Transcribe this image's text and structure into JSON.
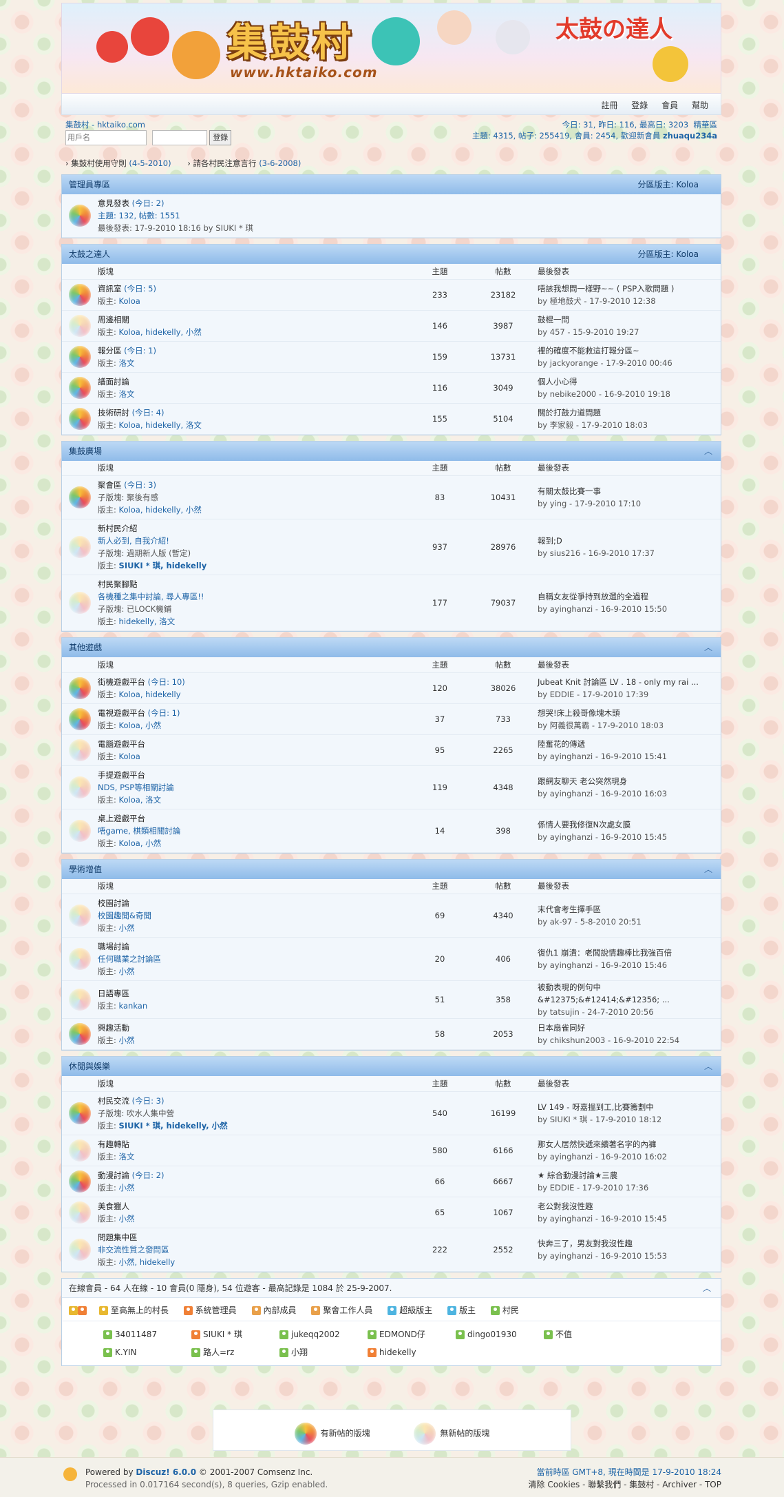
{
  "banner": {
    "title": "集鼓村",
    "url": "www.hktaiko.com",
    "logo2": "太鼓の達人"
  },
  "nav": [
    "註冊",
    "登錄",
    "會員",
    "幫助"
  ],
  "userbar": {
    "site": "集鼓村 - hktaiko.com",
    "user_placeholder": "用戶名",
    "login": "登錄",
    "stats1": "今日: 31, 昨日: 116, 最高日: 3203",
    "digest": "精華區",
    "stats2": "主題: 4315, 帖子: 255419, 會員: 2454, 歡迎新會員 ",
    "newmember": "zhuaqu234a",
    "notices": [
      {
        "title": "集鼓村使用守則",
        "date": "(4-5-2010)"
      },
      {
        "title": "請各村民注意言行",
        "date": "(3-6-2008)"
      }
    ]
  },
  "headers": {
    "forum": "版塊",
    "threads": "主題",
    "posts": "帖數",
    "last": "最後發表"
  },
  "cat_admin": {
    "name": "管理員專區",
    "mod": "分區版主: Koloa",
    "forum": {
      "name": "意見發表",
      "today": "(今日: 2)",
      "stats": "主題: 132, 帖數: 1551",
      "last": "最後發表: 17-9-2010 18:16 by ",
      "last_by": "SIUKI * 琪"
    }
  },
  "categories": [
    {
      "name": "太鼓之達人",
      "mod": "分區版主: Koloa",
      "forums": [
        {
          "name": "資訊室",
          "today": "(今日: 5)",
          "mods": "Koloa",
          "t": "233",
          "p": "23182",
          "lt": "唔該我想問一樣野~~ ( PSP入歌問題 )",
          "lb": "by 極地鼓犬 - 17-9-2010 12:38",
          "new": true
        },
        {
          "name": "周邊相關",
          "mods": "Koloa, hidekelly, 小然",
          "t": "146",
          "p": "3987",
          "lt": "鼓棍一問",
          "lb": "by 457 - 15-9-2010 19:27",
          "new": false
        },
        {
          "name": "報分區",
          "today": "(今日: 1)",
          "mods": "洛文",
          "t": "159",
          "p": "13731",
          "lt": "裡的確度不能救這打報分區~",
          "lb": "by jackyorange - 17-9-2010 00:46",
          "new": true
        },
        {
          "name": "譜面討論",
          "mods": "洛文",
          "t": "116",
          "p": "3049",
          "lt": "個人小心得",
          "lb": "by nebike2000 - 16-9-2010 19:18",
          "new": true
        },
        {
          "name": "技術研討",
          "today": "(今日: 4)",
          "mods": "Koloa, hidekelly, 洛文",
          "t": "155",
          "p": "5104",
          "lt": "關於打鼓力道問題",
          "lb": "by 李家毅 - 17-9-2010 18:03",
          "new": true
        }
      ]
    },
    {
      "name": "集鼓廣場",
      "mod": "",
      "forums": [
        {
          "name": "聚會區",
          "today": "(今日: 3)",
          "sub": "子版塊: 聚後有感",
          "mods": "Koloa, hidekelly, 小然",
          "t": "83",
          "p": "10431",
          "lt": "有關太鼓比賽一事",
          "lb": "by ying - 17-9-2010 17:10",
          "new": true
        },
        {
          "name": "新村民介紹",
          "desc": "新人必到, 自我介紹!",
          "sub": "子版塊: 過期新人版 (暫定)",
          "mods": "SIUKI * 琪, hidekelly",
          "t": "937",
          "p": "28976",
          "lt": "報到;D",
          "lb": "by sius216 - 16-9-2010 17:37",
          "new": false,
          "boldmods": true
        },
        {
          "name": "村民聚腳點",
          "desc": "各機種之集中討論, 尋人專區!!",
          "sub": "子版塊: 已LOCK機鋪",
          "mods": "hidekelly, 洛文",
          "t": "177",
          "p": "79037",
          "lt": "自稱女友從爭持到放還的全過程",
          "lb": "by ayinghanzi - 16-9-2010 15:50",
          "new": false
        }
      ]
    },
    {
      "name": "其他遊戲",
      "mod": "",
      "forums": [
        {
          "name": "街機遊戲平台",
          "today": "(今日: 10)",
          "mods": "Koloa, hidekelly",
          "t": "120",
          "p": "38026",
          "lt": "Jubeat Knit 討論區 LV . 18 - only my rai ...",
          "lb": "by EDDIE - 17-9-2010 17:39",
          "new": true
        },
        {
          "name": "電視遊戲平台",
          "today": "(今日: 1)",
          "mods": "Koloa, 小然",
          "t": "37",
          "p": "733",
          "lt": "想哭!床上殺哥像塊木頭",
          "lb": "by 阿義很萬霸 - 17-9-2010 18:03",
          "new": true
        },
        {
          "name": "電腦遊戲平台",
          "mods": "Koloa",
          "t": "95",
          "p": "2265",
          "lt": "陸奮花的傳遞",
          "lb": "by ayinghanzi - 16-9-2010 15:41",
          "new": false
        },
        {
          "name": "手提遊戲平台",
          "desc": "NDS, PSP等相關討論",
          "mods": "Koloa, 洛文",
          "t": "119",
          "p": "4348",
          "lt": "跟網友聊天 老公突然現身",
          "lb": "by ayinghanzi - 16-9-2010 16:03",
          "new": false
        },
        {
          "name": "桌上遊戲平台",
          "desc": "唔game, 棋類相關討論",
          "mods": "Koloa, 小然",
          "t": "14",
          "p": "398",
          "lt": "係情人要我修復N次處女膜",
          "lb": "by ayinghanzi - 16-9-2010 15:45",
          "new": false
        }
      ]
    },
    {
      "name": "學術增值",
      "mod": "",
      "forums": [
        {
          "name": "校園討論",
          "desc": "校園趣聞&奇聞",
          "mods": "小然",
          "t": "69",
          "p": "4340",
          "lt": "末代會考生擇手區",
          "lb": "by ak-97 - 5-8-2010 20:51",
          "new": false
        },
        {
          "name": "職場討論",
          "desc": "任何職業之討論區",
          "mods": "小然",
          "t": "20",
          "p": "406",
          "lt": "復仇1 崩潰：老闆說情趣棒比我強百倍",
          "lb": "by ayinghanzi - 16-9-2010 15:46",
          "new": false
        },
        {
          "name": "日語專區",
          "mods": "kankan",
          "t": "51",
          "p": "358",
          "lt": "被動表現的例句中&#12375;&#12414;&#12356; ...",
          "lb": "by tatsujin - 24-7-2010 20:56",
          "new": false
        },
        {
          "name": "興趣活動",
          "mods": "小然",
          "t": "58",
          "p": "2053",
          "lt": "日本扇雀同好",
          "lb": "by chikshun2003 - 16-9-2010 22:54",
          "new": true
        }
      ]
    },
    {
      "name": "休閒與娛樂",
      "mod": "",
      "forums": [
        {
          "name": "村民交流",
          "today": "(今日: 3)",
          "sub": "子版塊: 吹水人集中營",
          "mods": "SIUKI * 琪, hidekelly, 小然",
          "t": "540",
          "p": "16199",
          "lt": "LV 149 - 呀嘉搵到工,比賽籌劃中",
          "lb": "by SIUKI * 琪 - 17-9-2010 18:12",
          "new": true,
          "boldmods": true
        },
        {
          "name": "有趣轉貼",
          "mods": "洛文",
          "t": "580",
          "p": "6166",
          "lt": "那女人居然快遞來續著名字的內褲",
          "lb": "by ayinghanzi - 16-9-2010 16:02",
          "new": false
        },
        {
          "name": "動漫討論",
          "today": "(今日: 2)",
          "mods": "小然",
          "t": "66",
          "p": "6667",
          "lt": "★ 綜合動漫討論★三農",
          "lb": "by EDDIE - 17-9-2010 17:36",
          "new": true
        },
        {
          "name": "美食獵人",
          "mods": "小然",
          "t": "65",
          "p": "1067",
          "lt": "老公對我沒性趣",
          "lb": "by ayinghanzi - 16-9-2010 15:45",
          "new": false
        },
        {
          "name": "問題集中區",
          "desc": "非交流性質之發問區",
          "mods": "小然, hidekelly",
          "t": "222",
          "p": "2552",
          "lt": "快奔三了，男友對我沒性趣",
          "lb": "by ayinghanzi - 16-9-2010 15:53",
          "new": false
        }
      ]
    }
  ],
  "online": {
    "head": "在線會員 - 64 人在線 - 10 會員(0 隱身), 54 位遊客 - 最高記錄是 1084 於 25-9-2007.",
    "legend": [
      "至高無上的村長",
      "系統管理員",
      "內部成員",
      "聚會工作人員",
      "超級版主",
      "版主",
      "村民"
    ],
    "users": [
      [
        "34011487",
        "SIUKI * 琪",
        "jukeqq2002",
        "EDMOND仔",
        "dingo01930",
        "不值"
      ],
      [
        "K.YIN",
        "路人=rz",
        "小翔",
        "hidekelly"
      ]
    ]
  },
  "legendbox": {
    "new": "有新帖的版塊",
    "none": "無新帖的版塊"
  },
  "footer": {
    "powered": "Powered by ",
    "discuz": "Discuz! 6.0.0",
    "copy": " © 2001-2007 Comsenz Inc.",
    "proc": "Processed in 0.017164 second(s), 8 queries, Gzip enabled.",
    "tz": "當前時區 GMT+8, 現在時間是 17-9-2010 18:24",
    "links": "清除 Cookies - 聯繫我們 - 集鼓村 - Archiver - TOP"
  }
}
